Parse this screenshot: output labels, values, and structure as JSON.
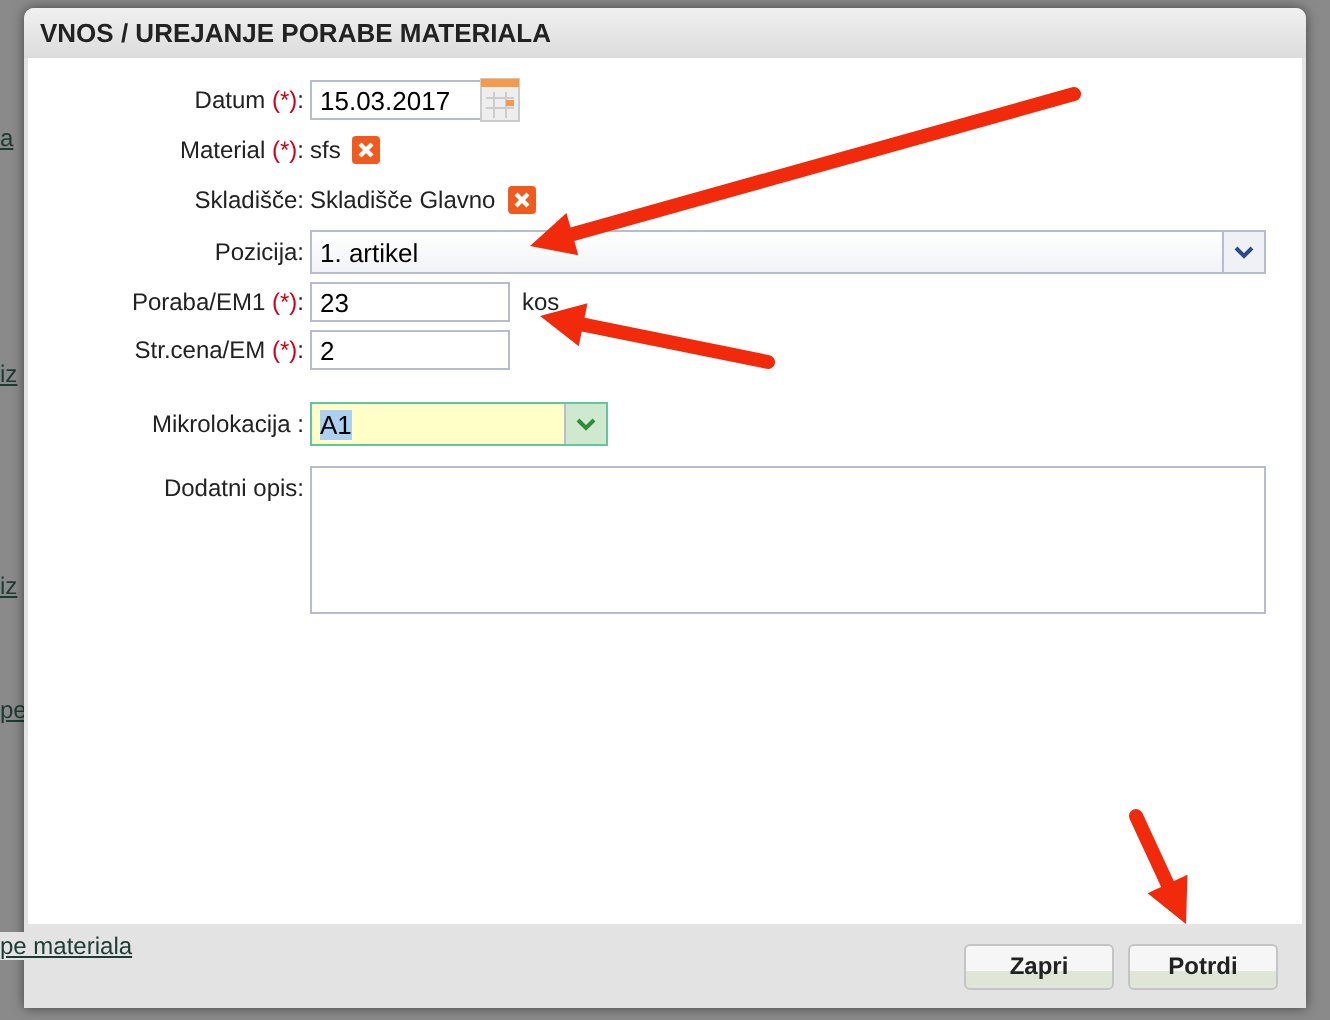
{
  "background": {
    "links": [
      "a",
      "iz",
      "iz",
      "pe"
    ],
    "footer_link": "pe materiala"
  },
  "dialog": {
    "title": "VNOS / UREJANJE PORABE MATERIALA",
    "fields": [
      {
        "kind": "date",
        "label": "Datum",
        "mark": "(*)",
        "suffix": ":",
        "value": "15.03.2017"
      },
      {
        "kind": "static",
        "label": "Material",
        "mark": "(*)",
        "suffix": ":",
        "value": "sfs",
        "removable": true
      },
      {
        "kind": "static",
        "label": "Skladišče:",
        "value": "Skladišče Glavno",
        "removable": true
      },
      {
        "kind": "select",
        "label": "Pozicija:",
        "value": "1. artikel"
      },
      {
        "kind": "input",
        "label": "Poraba/EM1",
        "mark": "(*)",
        "suffix": ":",
        "value": "23",
        "unit": "kos"
      },
      {
        "kind": "input",
        "label": "Str.cena/EM",
        "mark": "(*)",
        "suffix": ":",
        "value": "2"
      },
      {
        "kind": "combo",
        "label": "Mikrolokacija :",
        "value": "A1",
        "highlighted": true
      },
      {
        "kind": "textarea",
        "label": "Dodatni opis:"
      }
    ],
    "buttons": [
      "Zapri",
      "Potrdi"
    ]
  }
}
